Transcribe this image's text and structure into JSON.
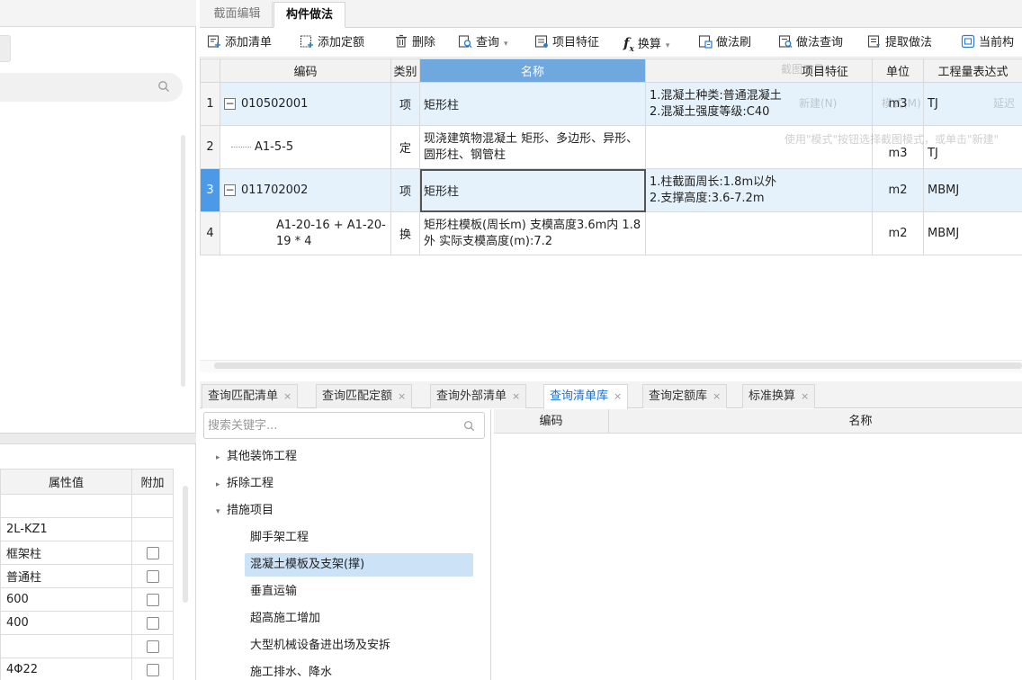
{
  "top_tabs": [
    "截面编辑",
    "构件做法"
  ],
  "toolbar": {
    "add_list": "添加清单",
    "add_quota": "添加定额",
    "delete": "删除",
    "query": "查询",
    "item_feature": "项目特征",
    "convert": "换算",
    "method_brush": "做法刷",
    "method_query": "做法查询",
    "extract_method": "提取做法",
    "current": "当前构"
  },
  "grid": {
    "headers": [
      "编码",
      "类别",
      "名称",
      "项目特征",
      "单位",
      "工程量表达式"
    ],
    "rows": [
      {
        "num": "1",
        "code": "010502001",
        "type": "项",
        "name": "矩形柱",
        "feature": "1.混凝土种类:普通混凝土\n2.混凝土强度等级:C40",
        "unit": "m3",
        "expr": "TJ"
      },
      {
        "num": "2",
        "code": "A1-5-5",
        "type": "定",
        "name": "现浇建筑物混凝土 矩形、多边形、异形、圆形柱、钢管柱",
        "feature": "",
        "unit": "m3",
        "expr": "TJ"
      },
      {
        "num": "3",
        "code": "011702002",
        "type": "项",
        "name": "矩形柱",
        "feature": "1.柱截面周长:1.8m以外\n2.支撑高度:3.6-7.2m",
        "unit": "m2",
        "expr": "MBMJ"
      },
      {
        "num": "4",
        "code": "A1-20-16 + A1-20-19 * 4",
        "type": "换",
        "name": "矩形柱模板(周长m) 支模高度3.6m内 1.8外  实际支模高度(m):7.2",
        "feature": "",
        "unit": "m2",
        "expr": "MBMJ"
      }
    ]
  },
  "ghost_popup": {
    "title": "截图工具",
    "new": "新建(N)",
    "mode": "模式(M)",
    "delay": "延迟",
    "hint": "使用\"模式\"按钮选择截图模式，或单击\"新建\""
  },
  "bottom_tabs": [
    "查询匹配清单",
    "查询匹配定额",
    "查询外部清单",
    "查询清单库",
    "查询定额库",
    "标准换算"
  ],
  "bottom_active_tab": "查询清单库",
  "search_placeholder": "搜索关键字...",
  "tree": {
    "items": [
      {
        "label": "其他装饰工程",
        "arrow": "▸"
      },
      {
        "label": "拆除工程",
        "arrow": "▸"
      },
      {
        "label": "措施项目",
        "arrow": "▾"
      }
    ],
    "children": [
      "脚手架工程",
      "混凝土模板及支架(撑)",
      "垂直运输",
      "超高施工增加",
      "大型机械设备进出场及安拆",
      "施工排水、降水"
    ],
    "selected": "混凝土模板及支架(撑)"
  },
  "bottom_grid_headers": [
    "编码",
    "名称"
  ],
  "properties": {
    "headers": [
      "属性值",
      "附加"
    ],
    "rows": [
      {
        "value": "",
        "checkbox": false
      },
      {
        "value": "2L-KZ1",
        "checkbox": false
      },
      {
        "value": "框架柱",
        "checkbox": true
      },
      {
        "value": "普通柱",
        "checkbox": true
      },
      {
        "value": "600",
        "checkbox": true
      },
      {
        "value": "400",
        "checkbox": true
      },
      {
        "value": "",
        "checkbox": true
      },
      {
        "value": "4Φ22",
        "checkbox": true
      }
    ]
  },
  "colors": {
    "selected_header": "#6ea8df",
    "row_highlight": "#e6f2fb",
    "active_row_number": "#4a9ae8",
    "active_tab_text": "#1e6fce",
    "tree_selected": "#cce3f7"
  }
}
